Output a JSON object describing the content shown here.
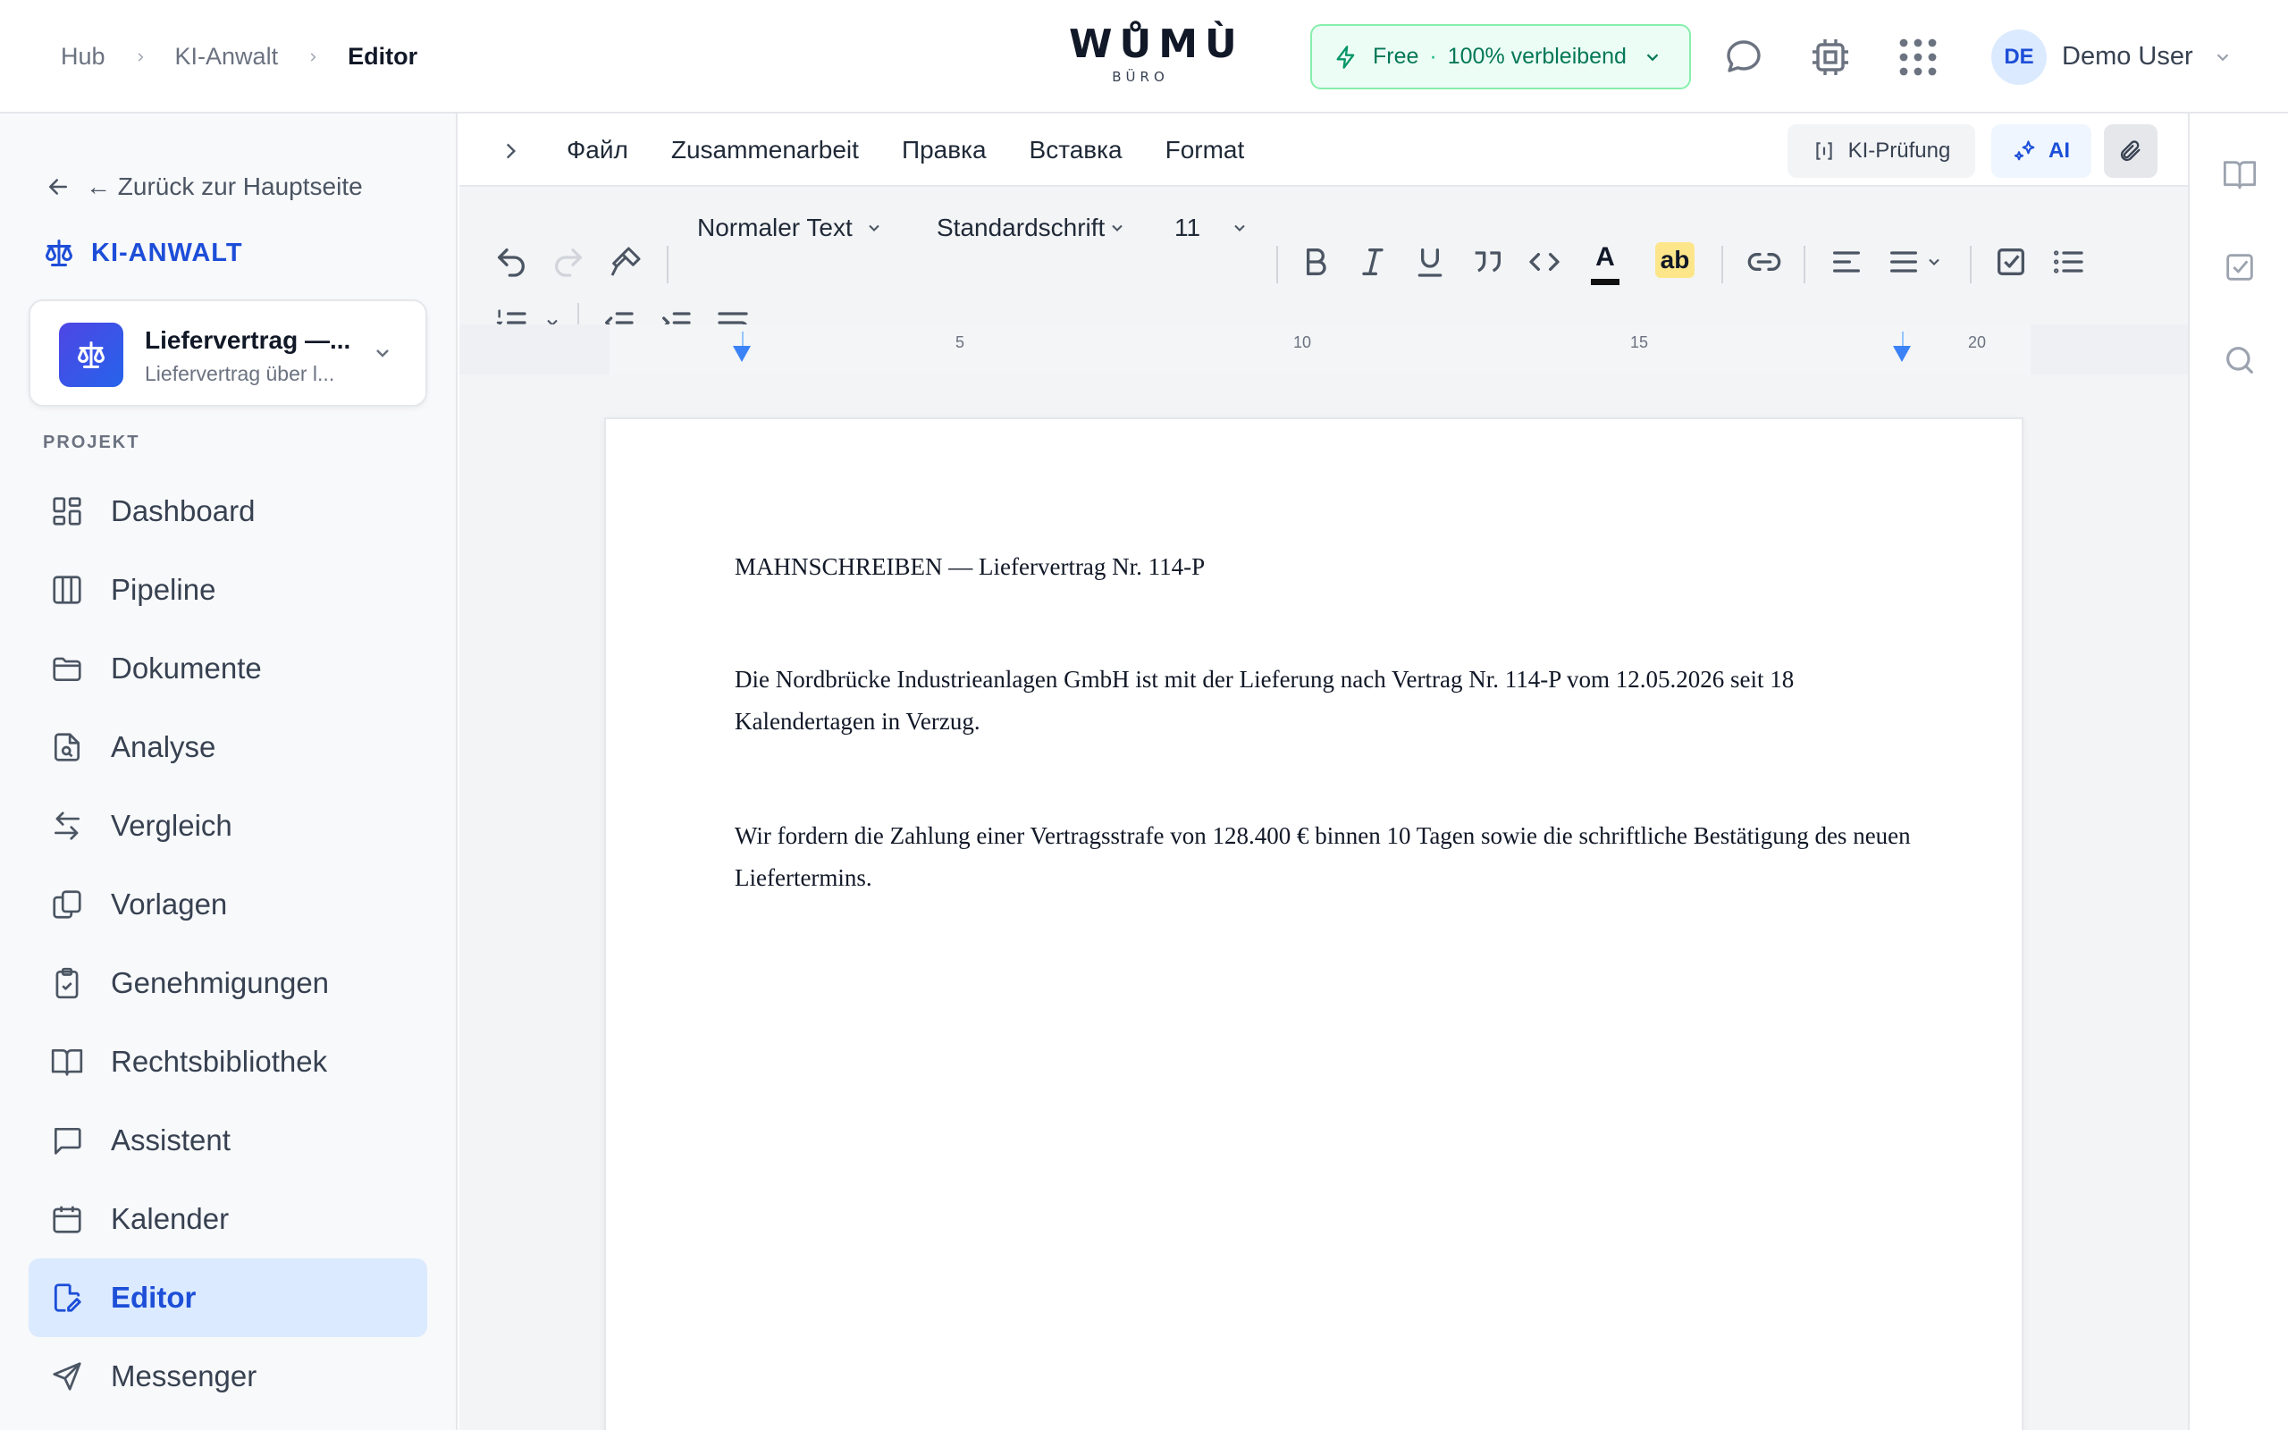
{
  "breadcrumb": {
    "items": [
      "Hub",
      "KI-Anwalt"
    ],
    "current": "Editor"
  },
  "logo": {
    "main": "WŮMÙ",
    "sub": "BÜRO"
  },
  "plan": {
    "tier": "Free",
    "separator": "·",
    "remaining": "100% verbleibend"
  },
  "user": {
    "initials": "DE",
    "name": "Demo User"
  },
  "sidebar": {
    "back_label": "← Zurück zur Hauptseite",
    "brand": "KI-ANWALT",
    "project": {
      "title": "Liefervertrag —...",
      "subtitle": "Liefervertrag über l..."
    },
    "section_label": "PROJEKT",
    "items": [
      {
        "label": "Dashboard",
        "icon": "dashboard-icon"
      },
      {
        "label": "Pipeline",
        "icon": "columns-icon"
      },
      {
        "label": "Dokumente",
        "icon": "folder-icon"
      },
      {
        "label": "Analyse",
        "icon": "file-search-icon"
      },
      {
        "label": "Vergleich",
        "icon": "arrows-compare-icon"
      },
      {
        "label": "Vorlagen",
        "icon": "copy-icon"
      },
      {
        "label": "Genehmigungen",
        "icon": "clipboard-check-icon"
      },
      {
        "label": "Rechtsbibliothek",
        "icon": "book-icon"
      },
      {
        "label": "Assistent",
        "icon": "message-icon"
      },
      {
        "label": "Kalender",
        "icon": "calendar-icon"
      },
      {
        "label": "Editor",
        "icon": "file-edit-icon",
        "active": true
      },
      {
        "label": "Messenger",
        "icon": "send-icon"
      }
    ]
  },
  "menubar": {
    "menus": [
      "Файл",
      "Zusammenarbeit",
      "Правка",
      "Вставка",
      "Format"
    ],
    "ki_check": "KI-Prüfung",
    "ai": "AI"
  },
  "toolbar": {
    "paragraph_style": "Normaler Text",
    "font": "Standardschrift",
    "font_size": "11",
    "highlight_sample": "ab",
    "text_color_sample": "A",
    "text_color": "#111111",
    "highlight_color": "#fde68a"
  },
  "ruler": {
    "labels": [
      "5",
      "10",
      "15",
      "20"
    ]
  },
  "document": {
    "title": "MAHNSCHREIBEN — Liefervertrag Nr. 114-P",
    "paragraph1": "Die Nordbrücke Industrieanlagen GmbH ist mit der Lieferung nach Vertrag Nr. 114-P vom 12.05.2026 seit 18 Kalendertagen in Verzug.",
    "paragraph2": "Wir fordern die Zahlung einer Vertragsstrafe von 128.400 € binnen 10 Tagen sowie die schriftliche Bestätigung des neuen Liefertermins."
  },
  "colors": {
    "accent": "#1d4ed8",
    "plan_bg": "#ecfdf5",
    "plan_text": "#047857",
    "active_nav_bg": "#dbeafe"
  }
}
